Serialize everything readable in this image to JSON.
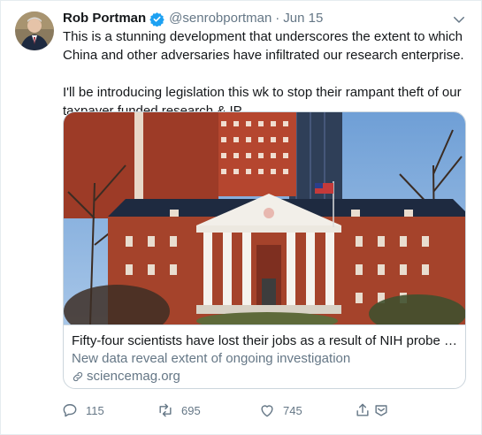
{
  "author": {
    "name": "Rob Portman",
    "handle": "@senrobportman",
    "separator": "·",
    "date": "Jun 15"
  },
  "tweet": {
    "paragraphs": [
      "This is a stunning development that underscores the extent to which China and other adversaries have infiltrated our research enterprise.",
      "I'll be introducing legislation this wk to stop their rampant theft of our taxpayer funded research & IP."
    ]
  },
  "card": {
    "title": "Fifty-four scientists have lost their jobs as a result of NIH probe into ...",
    "description": "New data reveal extent of ongoing investigation",
    "domain": "sciencemag.org"
  },
  "actions": {
    "reply_count": "115",
    "retweet_count": "695",
    "like_count": "745"
  },
  "colors": {
    "text": "#14171a",
    "muted": "#657786",
    "verified": "#1da1f2",
    "border": "#ccd6dd"
  },
  "icons": [
    "verified-badge-icon",
    "chevron-down-icon",
    "link-icon",
    "reply-icon",
    "retweet-icon",
    "like-icon",
    "share-icon",
    "dm-icon"
  ]
}
